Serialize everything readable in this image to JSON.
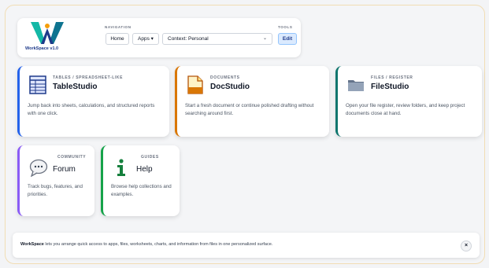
{
  "header": {
    "app_name": "WorkSpace v1.0",
    "nav_label": "NAVIGATION",
    "home_label": "Home",
    "apps_label": "Apps ▾",
    "context_value": "Context: Personal",
    "tools_label": "TOOLS",
    "edit_label": "Edit"
  },
  "cards": {
    "table": {
      "eyebrow": "TABLES / SPREADSHEET-LIKE",
      "title": "TableStudio",
      "desc": "Jump back into sheets, calculations, and structured reports with one click.",
      "icon": "spreadsheet-icon",
      "accent": "#2563eb"
    },
    "doc": {
      "eyebrow": "DOCUMENTS",
      "title": "DocStudio",
      "desc": "Start a fresh document or continue polished drafting without searching around first.",
      "icon": "document-icon",
      "accent": "#d97706"
    },
    "file": {
      "eyebrow": "FILES / REGISTER",
      "title": "FileStudio",
      "desc": "Open your file register, review folders, and keep project documents close at hand.",
      "icon": "folder-icon",
      "accent": "#0f766e"
    },
    "forum": {
      "eyebrow": "COMMUNITY",
      "title": "Forum",
      "desc": "Track bugs, features, and priorities.",
      "icon": "chat-bubble-icon",
      "accent": "#8b5cf6"
    },
    "help": {
      "eyebrow": "GUIDES",
      "title": "Help",
      "desc": "Browse help collections and examples.",
      "icon": "info-icon",
      "accent": "#16a34a"
    }
  },
  "footer": {
    "brand": "WorkSpace",
    "text": " lets you arrange quick access to apps, files, worksheets, charts, and information from files in one personalized surface.",
    "close_label": "×"
  }
}
